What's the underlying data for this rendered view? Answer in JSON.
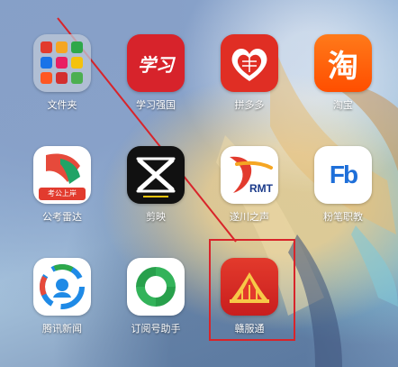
{
  "home_screen": {
    "apps": [
      {
        "label": "文件夹"
      },
      {
        "label": "学习强国",
        "icon_text": "学习"
      },
      {
        "label": "拼多多"
      },
      {
        "label": "淘宝",
        "icon_text": "淘"
      },
      {
        "label": "公考雷达",
        "icon_text": "考公上岸"
      },
      {
        "label": "剪映"
      },
      {
        "label": "遂川之声",
        "icon_text": "RMT"
      },
      {
        "label": "粉笔职教",
        "icon_text": "Fb"
      },
      {
        "label": "腾讯新闻"
      },
      {
        "label": "订阅号助手"
      },
      {
        "label": "赣服通"
      }
    ],
    "annotation": {
      "color": "#d8242a",
      "target": "赣服通"
    }
  }
}
